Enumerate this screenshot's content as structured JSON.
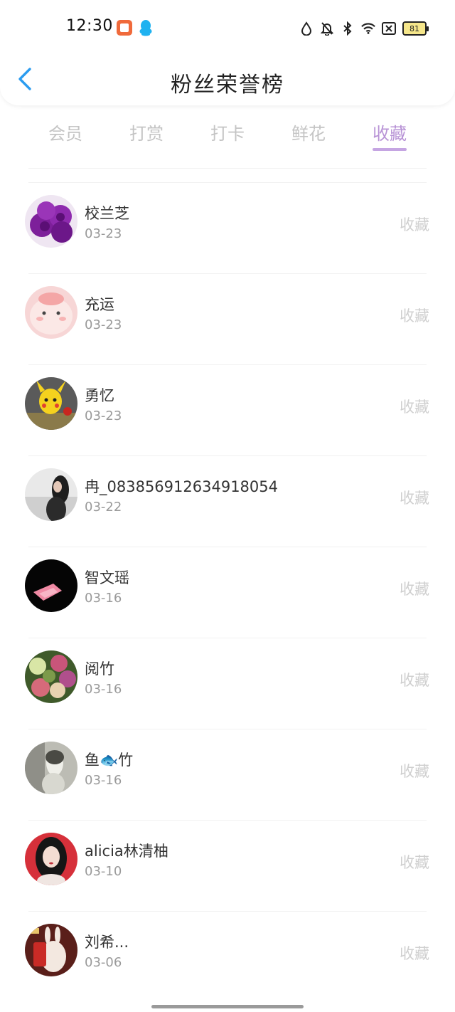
{
  "status_bar": {
    "time": "12:30",
    "battery": "81",
    "icons": [
      "book-app-icon",
      "qq-icon",
      "water-drop-icon",
      "bell-off-icon",
      "bluetooth-icon",
      "wifi-icon",
      "sim-x-icon"
    ]
  },
  "header": {
    "title": "粉丝荣誉榜",
    "back_icon": "chevron-left-icon"
  },
  "tabs": [
    {
      "label": "会员",
      "active": false
    },
    {
      "label": "打赏",
      "active": false
    },
    {
      "label": "打卡",
      "active": false
    },
    {
      "label": "鲜花",
      "active": false
    },
    {
      "label": "收藏",
      "active": true
    }
  ],
  "colors": {
    "accent": "#b893d6",
    "back_arrow": "#2b9cf0",
    "inactive_tab": "#c4c4c4"
  },
  "fans": [
    {
      "name": "校兰芝",
      "date": "03-23",
      "action": "收藏"
    },
    {
      "name": "充运",
      "date": "03-23",
      "action": "收藏"
    },
    {
      "name": "勇忆",
      "date": "03-23",
      "action": "收藏"
    },
    {
      "name": "冉_083856912634918054",
      "date": "03-22",
      "action": "收藏"
    },
    {
      "name": "智文瑶",
      "date": "03-16",
      "action": "收藏"
    },
    {
      "name": "阅竹",
      "date": "03-16",
      "action": "收藏"
    },
    {
      "name": "鱼🐟竹",
      "date": "03-16",
      "action": "收藏"
    },
    {
      "name": "alicia林清柚",
      "date": "03-10",
      "action": "收藏"
    },
    {
      "name": "刘希...",
      "date": "03-06",
      "action": "收藏"
    }
  ]
}
